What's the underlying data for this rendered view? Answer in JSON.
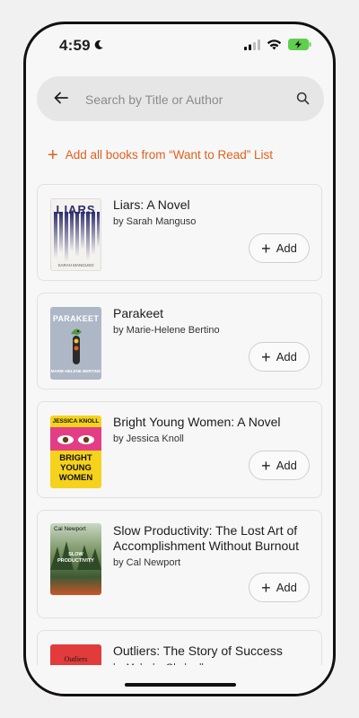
{
  "status_bar": {
    "time": "4:59"
  },
  "search": {
    "placeholder": "Search by Title or Author"
  },
  "add_all": {
    "label": "Add all books from “Want to Read” List"
  },
  "add_label": "Add",
  "books": [
    {
      "title": "Liars: A Novel",
      "author": "by Sarah Manguso",
      "cover_text": "LIARS",
      "cover_subtext": "SARAH MANGUSO"
    },
    {
      "title": "Parakeet",
      "author": "by Marie-Helene Bertino",
      "cover_text": "PARAKEET",
      "cover_subtext": "MARIE-HELENE BERTINO"
    },
    {
      "title": "Bright Young Women: A Novel",
      "author": "by Jessica Knoll",
      "cover_text": "BRIGHT YOUNG WOMEN",
      "cover_subtext": "JESSICA KNOLL"
    },
    {
      "title": "Slow Productivity: The Lost Art of Accomplishment Without Burnout",
      "author": "by Cal Newport",
      "cover_text": "SLOW PRODUCTIVITY",
      "cover_subtext": "Cal Newport"
    },
    {
      "title": "Outliers: The Story of Success",
      "author": "by Malcolm Gladwell",
      "cover_text": "Outliers",
      "cover_subtext": ""
    }
  ],
  "colors": {
    "accent": "#e0601e",
    "background": "#f7f7f7",
    "search_bg": "#e6e6e6",
    "battery": "#5fd04d"
  }
}
